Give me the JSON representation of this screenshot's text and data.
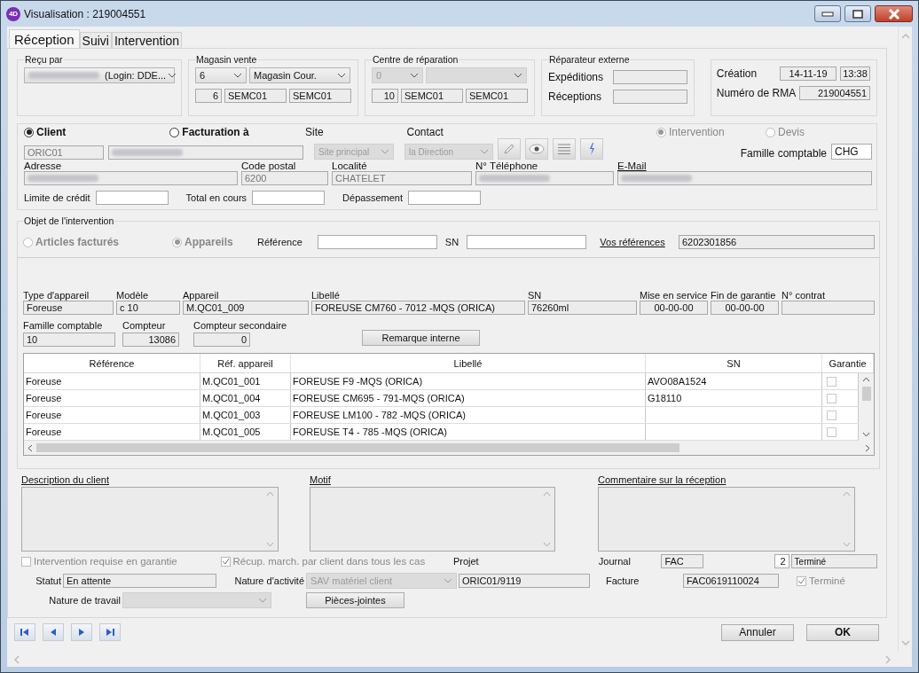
{
  "window": {
    "logo": "4D",
    "title": "Visualisation : 219004551"
  },
  "tabs": [
    {
      "label": "Réception",
      "selected": true
    },
    {
      "label": "Suivi",
      "selected": false
    },
    {
      "label": "Intervention",
      "selected": false
    }
  ],
  "recu_par": {
    "legend": "Reçu par",
    "user": "(Login: DDE..."
  },
  "magasin_vente": {
    "legend": "Magasin vente",
    "number": "6",
    "store": "Magasin Cour.",
    "code": "6",
    "fields": [
      "SEMC01",
      "SEMC01"
    ],
    "disabled": false
  },
  "centre_reparation": {
    "legend": "Centre de réparation",
    "number": "0",
    "code": "10",
    "fields": [
      "SEMC01",
      "SEMC01"
    ],
    "disabled": true
  },
  "reparateur_externe": {
    "legend": "Réparateur externe",
    "rows": [
      {
        "label": "Expéditions"
      },
      {
        "label": "Réceptions"
      }
    ]
  },
  "creation": {
    "label": "Création",
    "date": "14-11-19",
    "time": "13:38",
    "rma_label": "Numéro de RMA",
    "rma": "219004551"
  },
  "client": {
    "party": [
      {
        "label": "Client",
        "selected": true
      },
      {
        "label": "Facturation à",
        "selected": false
      }
    ],
    "code": "ORIC01",
    "site_label": "Site",
    "site": "Site principal",
    "contact_label": "Contact",
    "contact": "la Direction",
    "type": [
      {
        "label": "Intervention",
        "selected": true
      },
      {
        "label": "Devis",
        "selected": false
      }
    ],
    "famille_label": "Famille comptable",
    "famille": "CHG",
    "address": [
      {
        "label": "Adresse",
        "link": false
      },
      {
        "label": "Code postal",
        "value": "6200",
        "link": false
      },
      {
        "label": "Localité",
        "value": "CHATELET",
        "link": false
      },
      {
        "label": "N° Téléphone",
        "link": false
      },
      {
        "label": "E-Mail",
        "link": true
      }
    ],
    "credit": [
      {
        "label": "Limite de crédit"
      },
      {
        "label": "Total en cours"
      },
      {
        "label": "Dépassement"
      }
    ]
  },
  "objet": {
    "legend": "Objet de l'intervention",
    "kind": [
      {
        "label": "Articles facturés",
        "selected": false
      },
      {
        "label": "Appareils",
        "selected": true
      }
    ],
    "reference_label": "Référence",
    "sn_label": "SN",
    "vos_references_label": "Vos références",
    "vos_references": "6202301856"
  },
  "appareil": [
    {
      "label": "Type d'appareil",
      "value": "Foreuse"
    },
    {
      "label": "Modèle",
      "value": "c 10"
    },
    {
      "label": "Appareil",
      "value": "M.QC01_009"
    },
    {
      "label": "Libellé",
      "value": "FOREUSE CM760 - 7012 -MQS (ORICA)"
    },
    {
      "label": "SN",
      "value": "76260ml"
    },
    {
      "label": "Mise en service",
      "value": "00-00-00"
    },
    {
      "label": "Fin de garantie",
      "value": "00-00-00"
    },
    {
      "label": "N° contrat"
    }
  ],
  "compteurs": [
    {
      "label": "Famille comptable",
      "value": "10"
    },
    {
      "label": "Compteur",
      "value": "13086"
    },
    {
      "label": "Compteur secondaire",
      "value": "0"
    }
  ],
  "remarque_button": "Remarque interne",
  "table": {
    "columns": [
      "Référence",
      "Réf. appareil",
      "Libellé",
      "SN",
      "Garantie"
    ],
    "rows": [
      {
        "cells": [
          "Foreuse",
          "M.QC01_001",
          "FOREUSE F9 -MQS (ORICA)",
          "AVO08A1524"
        ],
        "garantie": false
      },
      {
        "cells": [
          "Foreuse",
          "M.QC01_004",
          "FOREUSE CM695 - 791-MQS (ORICA)",
          "G18110"
        ],
        "garantie": false
      },
      {
        "cells": [
          "Foreuse",
          "M.QC01_003",
          "FOREUSE LM100 - 782 -MQS (ORICA)"
        ],
        "garantie": false
      },
      {
        "cells": [
          "Foreuse",
          "M.QC01_005",
          "FOREUSE T4 - 785 -MQS (ORICA)"
        ],
        "garantie": false
      }
    ]
  },
  "memos": [
    {
      "label": "Description du client"
    },
    {
      "label": "Motif"
    },
    {
      "label": "Commentaire sur la réception"
    }
  ],
  "footer": {
    "garantie_check": {
      "label": "Intervention requise en garantie",
      "checked": false
    },
    "recup_check": {
      "label": "Récup. march. par client dans tous les cas",
      "checked": true
    },
    "projet_label": "Projet",
    "projet": "ORIC01/9119",
    "journal_label": "Journal",
    "journal": "FAC",
    "step": "2",
    "step_status": "Terminé",
    "statut_label": "Statut",
    "statut": "En attente",
    "activite_label": "Nature d'activité",
    "activite": "SAV matériel client",
    "facture_label": "Facture",
    "facture": "FAC0619110024",
    "termine_check": {
      "label": "Terminé",
      "checked": true
    },
    "travail_label": "Nature de travail",
    "pieces_button": "Pièces-jointes"
  },
  "buttons": [
    "Annuler",
    "OK"
  ]
}
